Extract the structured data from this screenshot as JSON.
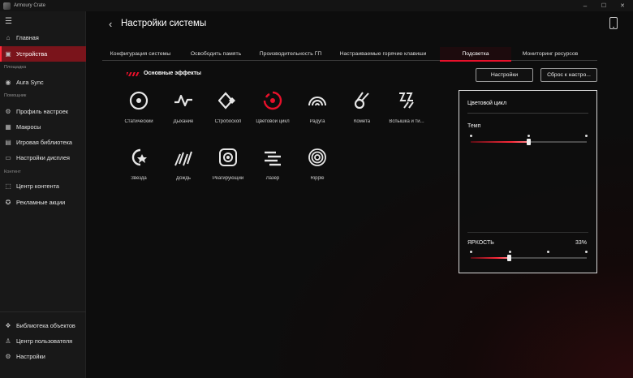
{
  "app": {
    "title": "Armoury Crate"
  },
  "window": {
    "minimize": "–",
    "maximize": "☐",
    "close": "✕"
  },
  "sidebar": {
    "items": [
      {
        "label": "Главная"
      },
      {
        "label": "Устройства"
      },
      {
        "label": "Aura Sync"
      },
      {
        "label": "Профиль настроек"
      },
      {
        "label": "Макросы"
      },
      {
        "label": "Игровая библиотека"
      },
      {
        "label": "Настройки дисплея"
      },
      {
        "label": "Центр контента"
      },
      {
        "label": "Рекламные акции"
      },
      {
        "label": "Библиотека объектов"
      },
      {
        "label": "Центр пользователя"
      },
      {
        "label": "Настройки"
      }
    ],
    "sections": [
      "Площадка",
      "Помощник",
      "Контент"
    ],
    "active_index": 1
  },
  "header": {
    "title": "Настройки системы"
  },
  "tabs": [
    {
      "label": "Конфигурация системы"
    },
    {
      "label": "Освободить память"
    },
    {
      "label": "Производительность ГП"
    },
    {
      "label": "Настраиваемые горячие клавиши"
    },
    {
      "label": "Подсветка"
    },
    {
      "label": "Мониторинг ресурсов"
    }
  ],
  "active_tab": 4,
  "section": {
    "title": "Основные эффекты"
  },
  "buttons": {
    "settings": "Настройки",
    "reset": "Сброс к настро..."
  },
  "effects": [
    {
      "label": "Статический",
      "icon": "static-icon"
    },
    {
      "label": "Дыхание",
      "icon": "breathing-icon"
    },
    {
      "label": "Стробоскоп",
      "icon": "strobe-icon"
    },
    {
      "label": "Цветовой цикл",
      "icon": "color-cycle-icon"
    },
    {
      "label": "Радуга",
      "icon": "rainbow-icon"
    },
    {
      "label": "Комета",
      "icon": "comet-icon"
    },
    {
      "label": "Вспышка и ти...",
      "icon": "flash-dash-icon"
    },
    {
      "label": "Звезда",
      "icon": "star-icon"
    },
    {
      "label": "Дождь",
      "icon": "rain-icon"
    },
    {
      "label": "Реагирующий",
      "icon": "reactive-icon"
    },
    {
      "label": "Лазер",
      "icon": "laser-icon"
    },
    {
      "label": "Ripple",
      "icon": "ripple-icon"
    }
  ],
  "selected_effect": 3,
  "panel": {
    "title": "Цветовой цикл",
    "speed_label": "Темп",
    "speed_fraction": 0.5,
    "brightness_label": "ЯРКОСТЬ",
    "brightness_value": "33%",
    "brightness_fraction": 0.33
  },
  "colors": {
    "accent": "#e8102a",
    "active_nav": "#7a141b",
    "background": "#0d0d0d"
  }
}
